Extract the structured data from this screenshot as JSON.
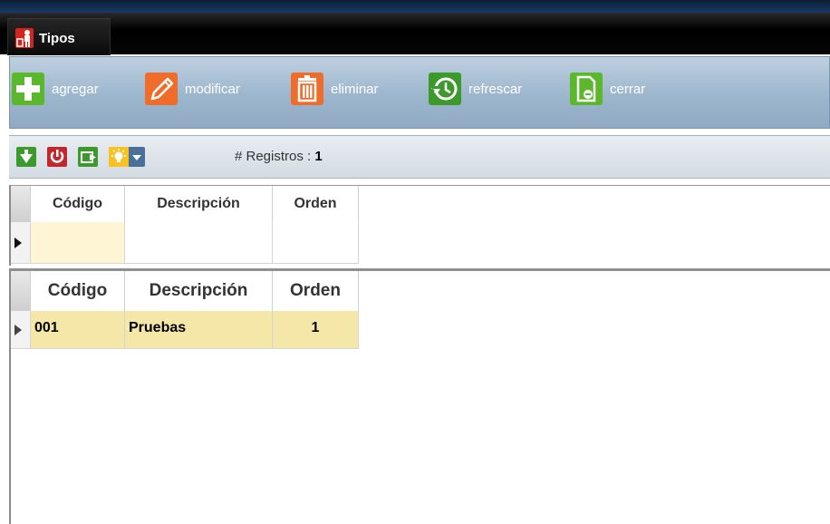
{
  "window": {
    "tab_title": "Tipos"
  },
  "toolbar": {
    "buttons": [
      {
        "label": "agregar",
        "icon": "plus-icon",
        "color": "#5cb82b"
      },
      {
        "label": "modificar",
        "icon": "pencil-icon",
        "color": "#ef6c2b"
      },
      {
        "label": "eliminar",
        "icon": "trash-icon",
        "color": "#ef6c2b"
      },
      {
        "label": "refrescar",
        "icon": "refresh-icon",
        "color": "#3c9a2c"
      },
      {
        "label": "cerrar",
        "icon": "document-close-icon",
        "color": "#5cb82b"
      }
    ]
  },
  "subtoolbar": {
    "records_label": "# Registros :",
    "records_count": "1",
    "icons": [
      "filter-icon",
      "power-icon",
      "export-icon",
      "bulb-dropdown-icon"
    ]
  },
  "filter_grid": {
    "headers": [
      "Código",
      "Descripción",
      "Orden"
    ],
    "row": [
      "",
      "",
      ""
    ]
  },
  "data_grid": {
    "headers": [
      "Código",
      "Descripción",
      "Orden"
    ],
    "rows": [
      {
        "codigo": "001",
        "descripcion": "Pruebas",
        "orden": "1"
      }
    ]
  },
  "colors": {
    "toolbar_bg": "#a7bed3",
    "row_highlight": "#f5e7a7",
    "filter_cell": "#fdf5d3"
  }
}
